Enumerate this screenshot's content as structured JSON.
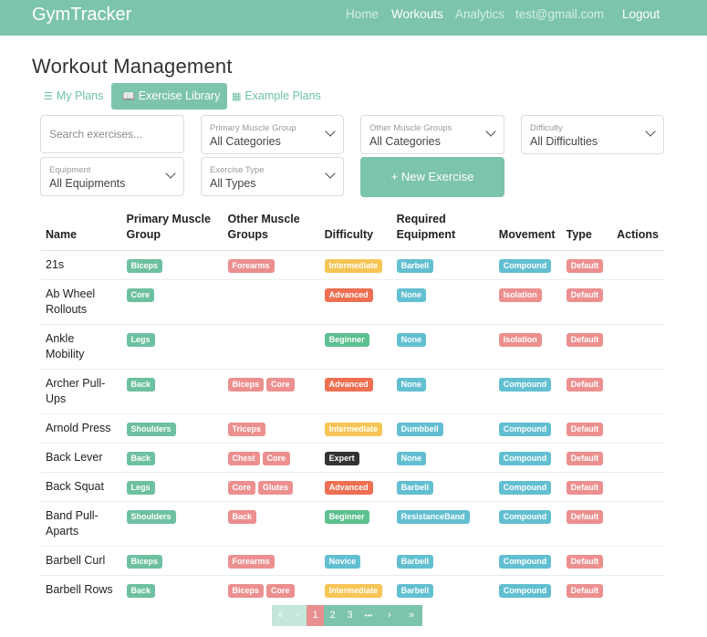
{
  "app": {
    "brand": "GymTracker"
  },
  "nav": {
    "home": "Home",
    "workouts": "Workouts",
    "analytics": "Analytics",
    "user": "test@gmail.com",
    "logout": "Logout"
  },
  "page": {
    "title": "Workout Management"
  },
  "tabs": [
    {
      "label": "My Plans",
      "icon": "list-icon"
    },
    {
      "label": "Exercise Library",
      "icon": "book-icon"
    },
    {
      "label": "Example Plans",
      "icon": "table-icon"
    }
  ],
  "filters": {
    "search_placeholder": "Search exercises...",
    "primary": {
      "label": "Primary Muscle Group",
      "value": "All Categories"
    },
    "other": {
      "label": "Other Muscle Groups",
      "value": "All Categories"
    },
    "difficulty": {
      "label": "Difficulty",
      "value": "All Difficulties"
    },
    "equipment": {
      "label": "Equipment",
      "value": "All Equipments"
    },
    "type": {
      "label": "Exercise Type",
      "value": "All Types"
    },
    "new_button": "+ New Exercise"
  },
  "table": {
    "headers": [
      "Name",
      "Primary Muscle Group",
      "Other Muscle Groups",
      "Difficulty",
      "Required Equipment",
      "Movement",
      "Type",
      "Actions"
    ],
    "rows": [
      {
        "name": "21s",
        "primary": "Biceps",
        "other": [
          "Forearms"
        ],
        "difficulty": "Intermediate",
        "equipment": "Barbell",
        "movement": "Compound",
        "type": "Default"
      },
      {
        "name": "Ab Wheel Rollouts",
        "primary": "Core",
        "other": [],
        "difficulty": "Advanced",
        "equipment": "None",
        "movement": "Isolation",
        "type": "Default"
      },
      {
        "name": "Ankle Mobility",
        "primary": "Legs",
        "other": [],
        "difficulty": "Beginner",
        "equipment": "None",
        "movement": "Isolation",
        "type": "Default"
      },
      {
        "name": "Archer Pull-Ups",
        "primary": "Back",
        "other": [
          "Biceps",
          "Core"
        ],
        "difficulty": "Advanced",
        "equipment": "None",
        "movement": "Compound",
        "type": "Default"
      },
      {
        "name": "Arnold Press",
        "primary": "Shoulders",
        "other": [
          "Triceps"
        ],
        "difficulty": "Intermediate",
        "equipment": "Dumbbell",
        "movement": "Compound",
        "type": "Default"
      },
      {
        "name": "Back Lever",
        "primary": "Back",
        "other": [
          "Chest",
          "Core"
        ],
        "difficulty": "Expert",
        "equipment": "None",
        "movement": "Compound",
        "type": "Default"
      },
      {
        "name": "Back Squat",
        "primary": "Legs",
        "other": [
          "Core",
          "Glutes"
        ],
        "difficulty": "Advanced",
        "equipment": "Barbell",
        "movement": "Compound",
        "type": "Default"
      },
      {
        "name": "Band Pull-Aparts",
        "primary": "Shoulders",
        "other": [
          "Back"
        ],
        "difficulty": "Beginner",
        "equipment": "ResistanceBand",
        "movement": "Compound",
        "type": "Default"
      },
      {
        "name": "Barbell Curl",
        "primary": "Biceps",
        "other": [
          "Forearms"
        ],
        "difficulty": "Novice",
        "equipment": "Barbell",
        "movement": "Compound",
        "type": "Default"
      },
      {
        "name": "Barbell Rows",
        "primary": "Back",
        "other": [
          "Biceps",
          "Core"
        ],
        "difficulty": "Intermediate",
        "equipment": "Barbell",
        "movement": "Compound",
        "type": "Default"
      }
    ]
  },
  "pagination": {
    "first": "«",
    "prev": "‹",
    "pages": [
      "1",
      "2",
      "3"
    ],
    "ellipsis": "•••",
    "next": "›",
    "last": "»",
    "current": "1"
  },
  "colors": {
    "brand": "#7cc4ab",
    "primary_badge": "#6dc0a0",
    "other_badge": "#ec8f8f",
    "equipment_badge": "#62bfd1",
    "movement_compound": "#62bfd1",
    "movement_isolation": "#ec8f8f",
    "type_badge": "#ec8f8f",
    "difficulty": {
      "Intermediate": "#f7c555",
      "Advanced": "#ee6f52",
      "Beginner": "#5dc08f",
      "Expert": "#333333",
      "Novice": "#62bfd1"
    }
  }
}
